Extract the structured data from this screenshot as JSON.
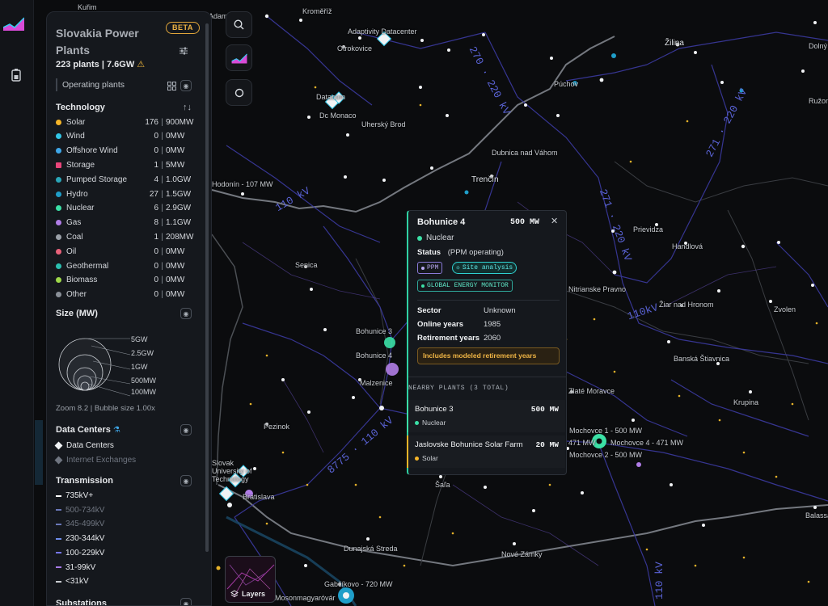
{
  "app": {
    "title_line1": "Slovakia Power",
    "title_line2": "Plants",
    "beta_label": "BETA",
    "stats": "223 plants | 7.6GW",
    "filter_label": "Operating plants"
  },
  "technology": {
    "heading": "Technology",
    "sort_icon": "sort-arrows-icon",
    "items": [
      {
        "name": "Solar",
        "count": "176",
        "capacity": "900MW",
        "color": "#f5b529"
      },
      {
        "name": "Wind",
        "count": "0",
        "capacity": "0MW",
        "color": "#32c6e6"
      },
      {
        "name": "Offshore Wind",
        "count": "0",
        "capacity": "0MW",
        "color": "#3fa7e8"
      },
      {
        "name": "Storage",
        "count": "1",
        "capacity": "5MW",
        "color": "#e8457a"
      },
      {
        "name": "Pumped Storage",
        "count": "4",
        "capacity": "1.0GW",
        "color": "#2aa6b8"
      },
      {
        "name": "Hydro",
        "count": "27",
        "capacity": "1.5GW",
        "color": "#1f9ec9"
      },
      {
        "name": "Nuclear",
        "count": "6",
        "capacity": "2.9GW",
        "color": "#3be0a6"
      },
      {
        "name": "Gas",
        "count": "8",
        "capacity": "1.1GW",
        "color": "#b07de6"
      },
      {
        "name": "Coal",
        "count": "1",
        "capacity": "208MW",
        "color": "#9aa0a8"
      },
      {
        "name": "Oil",
        "count": "0",
        "capacity": "0MW",
        "color": "#e8627a"
      },
      {
        "name": "Geothermal",
        "count": "0",
        "capacity": "0MW",
        "color": "#2bbfb0"
      },
      {
        "name": "Biomass",
        "count": "0",
        "capacity": "0MW",
        "color": "#9ed84a"
      },
      {
        "name": "Other",
        "count": "0",
        "capacity": "0MW",
        "color": "#8a9098"
      }
    ]
  },
  "size": {
    "heading": "Size (MW)",
    "labels": [
      "5GW",
      "2.5GW",
      "1GW",
      "500MW",
      "100MW"
    ],
    "zoom_line": "Zoom 8.2 | Bubble size 1.00x"
  },
  "data_centers": {
    "heading": "Data Centers",
    "items": [
      {
        "label": "Data Centers",
        "color": "#f1f3f5"
      },
      {
        "label": "Internet Exchanges",
        "color": "#6f7580"
      }
    ]
  },
  "transmission": {
    "heading": "Transmission",
    "items": [
      {
        "label": "735kV+",
        "color": "#ffffff"
      },
      {
        "label": "500-734kV",
        "color": "#6a78b8"
      },
      {
        "label": "345-499kV",
        "color": "#6a78b8"
      },
      {
        "label": "230-344kV",
        "color": "#6f8dea"
      },
      {
        "label": "100-229kV",
        "color": "#7676f0"
      },
      {
        "label": "31-99kV",
        "color": "#a77ae8"
      },
      {
        "label": "<31kV",
        "color": "#c9cdd2"
      }
    ]
  },
  "substations": {
    "heading": "Substations"
  },
  "map_controls": {
    "search_icon": "search-icon",
    "logo_icon": "chart-logo-icon",
    "circle_icon": "circle-icon",
    "layers_label": "Layers"
  },
  "popup": {
    "title": "Bohunice 4",
    "capacity": "500 MW",
    "type": "Nuclear",
    "status_label": "Status",
    "status_value": "(PPM operating)",
    "tag_ppm": "PPM",
    "tag_site": "Site analysis",
    "tag_gem": "GLOBAL ENERGY MONITOR",
    "fields": [
      {
        "k": "Sector",
        "v": "Unknown"
      },
      {
        "k": "Online years",
        "v": "1985"
      },
      {
        "k": "Retirement years",
        "v": "2060"
      }
    ],
    "note": "Includes modeled retirement years",
    "nearby_heading": "NEARBY PLANTS (3 TOTAL)",
    "nearby": [
      {
        "name": "Bohunice 3",
        "capacity": "500 MW",
        "type": "Nuclear",
        "color": "#3be0a6"
      },
      {
        "name": "Jaslovske Bohunice Solar Farm",
        "capacity": "20 MW",
        "type": "Solar",
        "color": "#f5b529"
      }
    ]
  },
  "map": {
    "places": [
      "Kuřim",
      "Kroměříž",
      "Adamov",
      "Adaptivity Datacenter",
      "Otrokovice",
      "Žilina",
      "Dolný",
      "Púchov",
      "Ružomberok",
      "Datacom",
      "Dc Monaco",
      "Uherský Brod",
      "Dubnica nad Váhom",
      "Trenčín",
      "Hodonín - 107 MW",
      "Prievidza",
      "Handlová",
      "Senica",
      "Nitrianske Pravno",
      "Žiar nad Hronom",
      "Zvolen",
      "Bohunice 3",
      "Bohunice 4",
      "Malzenice",
      "Banská Štiavnica",
      "Zlaté Moravce",
      "Krupina",
      "Pezinok",
      "Mochovce 1 - 500 MW",
      "Mochovce 4 - 471 MW",
      "471 MW",
      "Mochovce 2 - 500 MW",
      "Slovak University of Technology",
      "Bratislava",
      "Šaľa",
      "Dunajská Streda",
      "Nové Zámky",
      "Gabčíkovo - 720 MW",
      "Mosonmagyaróvár",
      "Balassagyarmat"
    ],
    "kv_labels": [
      "270 · 220 kV",
      "271 · 220 kV",
      "271 · 220 kV",
      "110 kV",
      "110kV",
      "8775 · 110 kV",
      "110 kV"
    ]
  }
}
